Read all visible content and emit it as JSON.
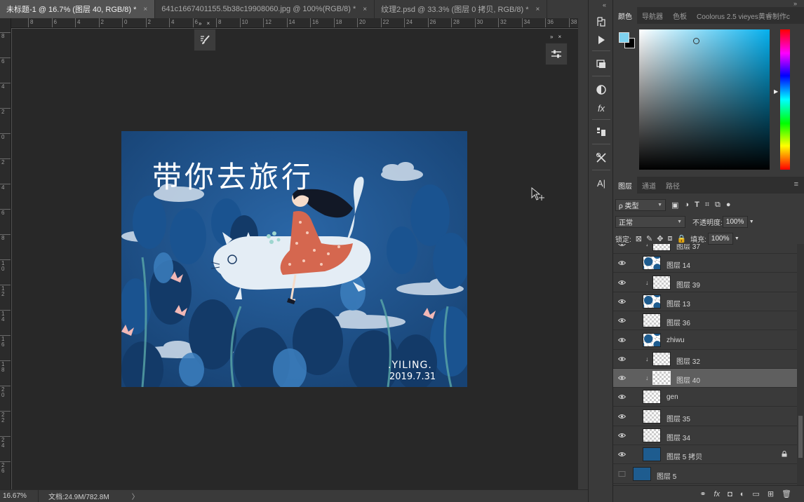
{
  "tabs": [
    {
      "label": "未标题-1 @ 16.7% (图层 40, RGB/8) *",
      "active": true
    },
    {
      "label": "641c1667401155.5b38c19908060.jpg @ 100%(RGB/8) *",
      "active": false
    },
    {
      "label": "纹理2.psd @ 33.3% (图层 0 拷贝, RGB/8) *",
      "active": false
    }
  ],
  "close_glyph": "×",
  "ruler_top_labels": [
    "8",
    "6",
    "4",
    "2",
    "0",
    "2",
    "4",
    "6",
    "8",
    "10",
    "12",
    "14",
    "16",
    "18",
    "20",
    "22",
    "24",
    "26",
    "28",
    "30",
    "32",
    "34",
    "36",
    "38"
  ],
  "ruler_left_labels": [
    "8",
    "6",
    "4",
    "2",
    "0",
    "2",
    "4",
    "6",
    "8",
    "10",
    "12",
    "14",
    "16",
    "18",
    "20",
    "22",
    "24",
    "26"
  ],
  "artwork": {
    "title": "带你去旅行",
    "signature_name": ".YILING.",
    "signature_date": "2019.7.31"
  },
  "status": {
    "zoom": "16.67%",
    "doc": "文档:24.9M/782.8M",
    "arrow": "〉"
  },
  "color_panel": {
    "tabs": [
      "颜色",
      "导航器",
      "色板",
      "Coolorus 2.5 vieyes黄睿制作c"
    ],
    "foreground": "#7fd2ef",
    "background": "#000000"
  },
  "layers_panel": {
    "tabs": [
      "图层",
      "通道",
      "路径"
    ],
    "filter_label": "ρ 类型",
    "blend_mode": "正常",
    "opacity_label": "不透明度:",
    "opacity_value": "100%",
    "lock_label": "锁定:",
    "fill_label": "填充:",
    "fill_value": "100%",
    "layers": [
      {
        "name": "图层 37",
        "clip": true,
        "visible": true,
        "thumb": "checker",
        "selected": false
      },
      {
        "name": "图层 14",
        "clip": false,
        "visible": true,
        "thumb": "art",
        "selected": false
      },
      {
        "name": "图层 39",
        "clip": true,
        "visible": true,
        "thumb": "checker",
        "selected": false
      },
      {
        "name": "图层 13",
        "clip": false,
        "visible": true,
        "thumb": "art",
        "selected": false
      },
      {
        "name": "图层 36",
        "clip": false,
        "visible": true,
        "thumb": "checker",
        "selected": false
      },
      {
        "name": "zhiwu",
        "clip": false,
        "visible": true,
        "thumb": "art",
        "selected": false
      },
      {
        "name": "图层 32",
        "clip": true,
        "visible": true,
        "thumb": "checker",
        "selected": false
      },
      {
        "name": "图层 40",
        "clip": true,
        "visible": true,
        "thumb": "checker",
        "selected": true
      },
      {
        "name": "gen",
        "clip": false,
        "visible": true,
        "thumb": "checker",
        "selected": false
      },
      {
        "name": "图层 35",
        "clip": false,
        "visible": true,
        "thumb": "checker",
        "selected": false
      },
      {
        "name": "图层 34",
        "clip": false,
        "visible": true,
        "thumb": "checker",
        "selected": false
      },
      {
        "name": "图层 5 拷贝",
        "clip": false,
        "visible": true,
        "thumb": "solid",
        "selected": false,
        "locked": true
      },
      {
        "name": "图层 5",
        "clip": false,
        "visible": false,
        "thumb": "solid",
        "selected": false
      }
    ],
    "bottom_icons": [
      "link-icon",
      "fx-icon",
      "mask-icon",
      "adjustment-icon",
      "group-icon",
      "new-layer-icon",
      "delete-icon"
    ]
  },
  "colors": {
    "accent_blue": "#1c4d86",
    "selected_row": "#5f5f5f"
  }
}
